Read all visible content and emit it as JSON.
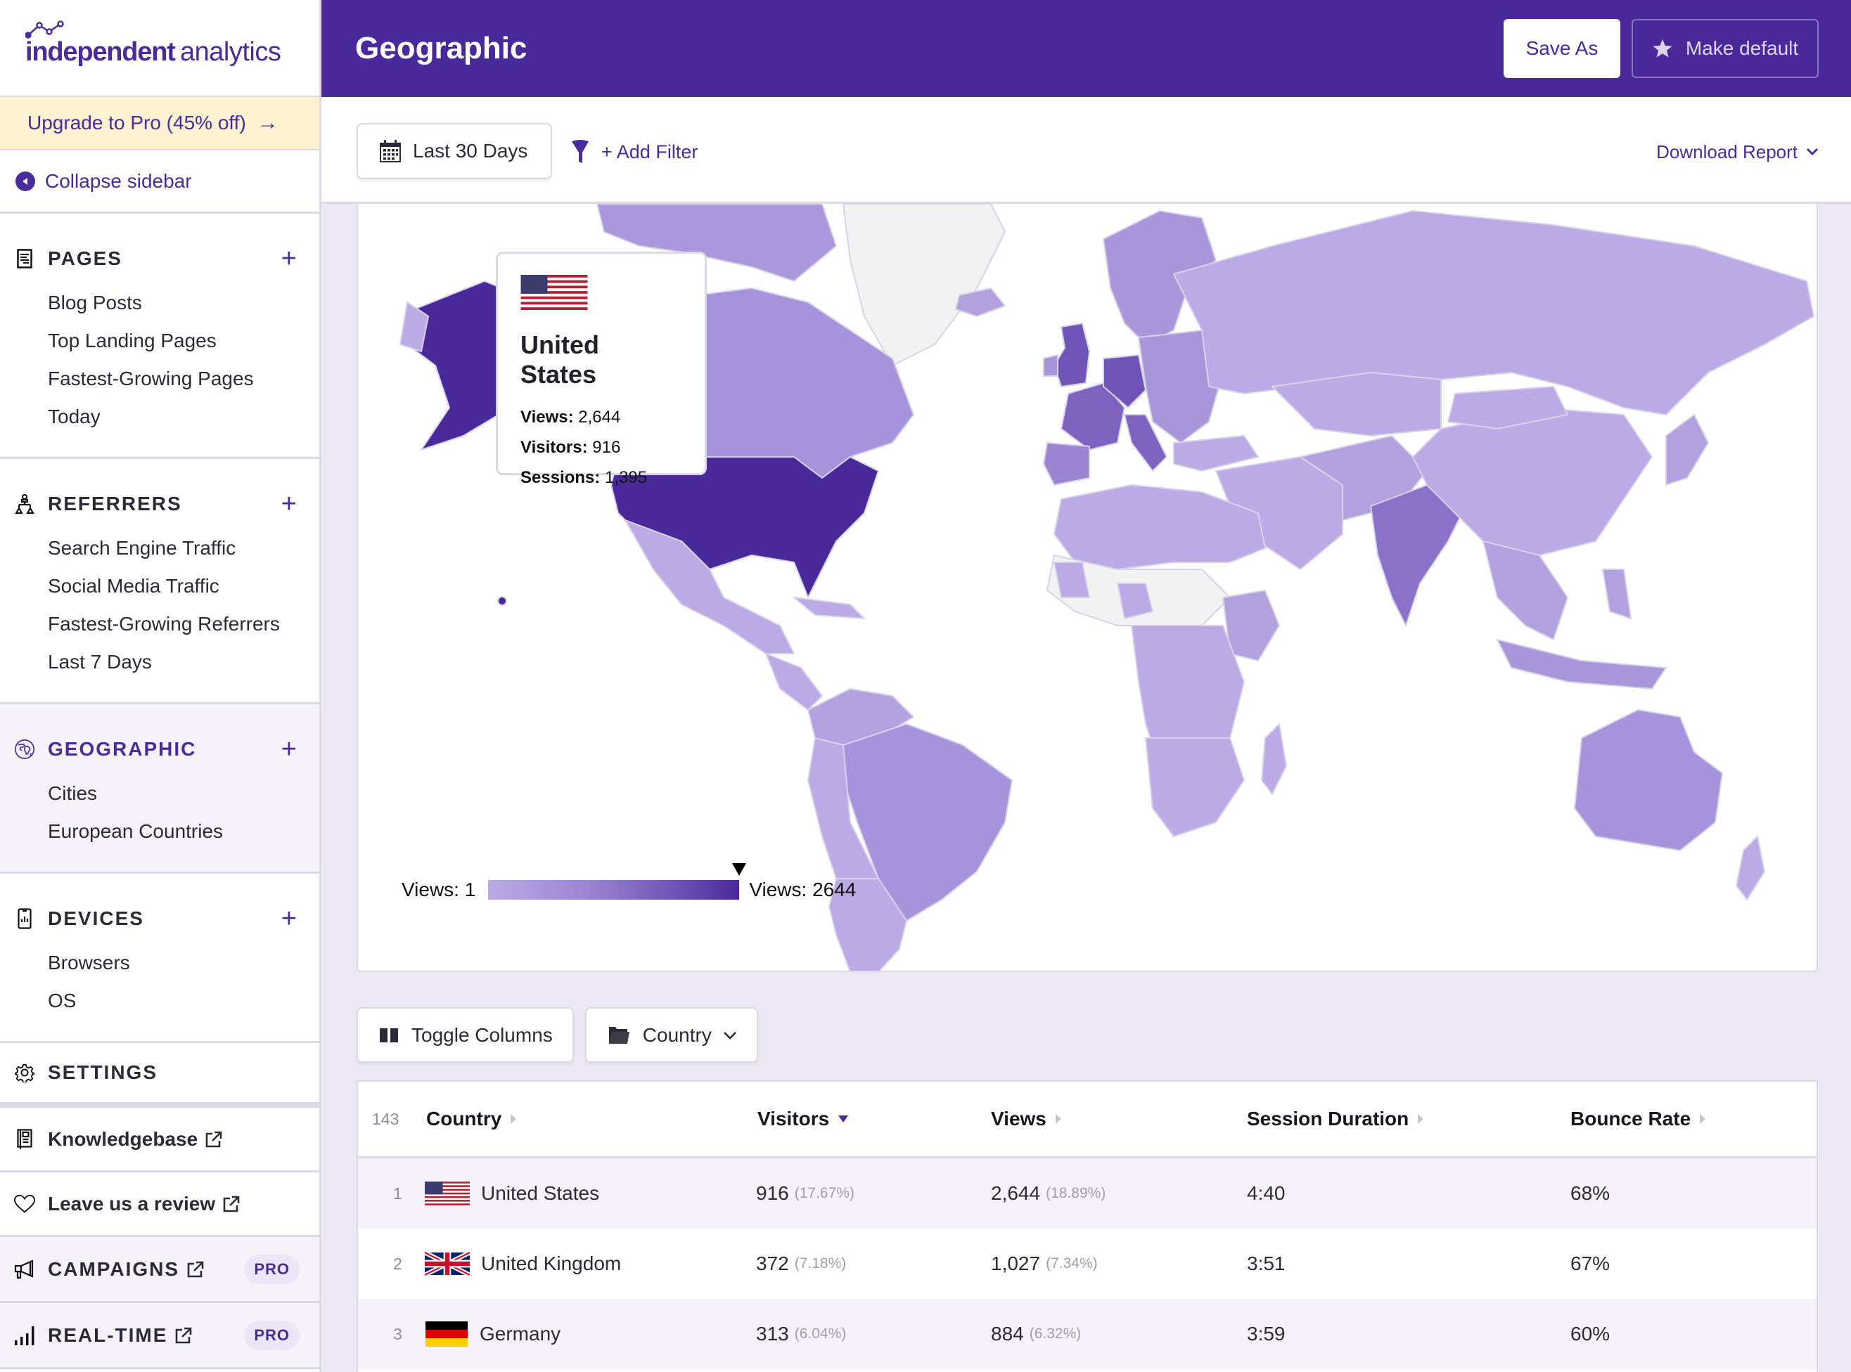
{
  "app": {
    "logo_bold": "independent",
    "logo_light": "analytics"
  },
  "sidebar": {
    "upgrade_label": "Upgrade to Pro (45% off)",
    "collapse_label": "Collapse sidebar",
    "sections": [
      {
        "title": "PAGES",
        "icon": "document-icon",
        "items": [
          "Blog Posts",
          "Top Landing Pages",
          "Fastest-Growing Pages",
          "Today"
        ]
      },
      {
        "title": "REFERRERS",
        "icon": "network-icon",
        "items": [
          "Search Engine Traffic",
          "Social Media Traffic",
          "Fastest-Growing Referrers",
          "Last 7 Days"
        ]
      },
      {
        "title": "GEOGRAPHIC",
        "icon": "globe-icon",
        "active": true,
        "items": [
          "Cities",
          "European Countries"
        ]
      },
      {
        "title": "DEVICES",
        "icon": "phone-chart-icon",
        "items": [
          "Browsers",
          "OS"
        ]
      }
    ],
    "settings_label": "SETTINGS",
    "knowledgebase_label": "Knowledgebase",
    "review_label": "Leave us a review",
    "campaigns_label": "CAMPAIGNS",
    "realtime_label": "REAL-TIME",
    "pro_badge": "PRO"
  },
  "header": {
    "title": "Geographic",
    "save_as_label": "Save As",
    "make_default_label": "Make default"
  },
  "filters": {
    "date_range": "Last 30 Days",
    "add_filter_label": "+ Add Filter",
    "download_label": "Download Report"
  },
  "map": {
    "tooltip": {
      "country": "United States",
      "views_label": "Views:",
      "views": "2,644",
      "visitors_label": "Visitors:",
      "visitors": "916",
      "sessions_label": "Sessions:",
      "sessions": "1,395"
    },
    "legend": {
      "min_label": "Views: 1",
      "max_label": "Views: 2644",
      "min": 1,
      "max": 2644,
      "hovered_value": 2644
    },
    "colors": {
      "max": "#4a2a9a",
      "high": "#7d62c0",
      "mid": "#a895da",
      "low": "#bcaae6",
      "none": "#f2f2f2"
    }
  },
  "table_toolbar": {
    "toggle_columns_label": "Toggle Columns",
    "group_by_label": "Country"
  },
  "table": {
    "row_count": "143",
    "columns": [
      "Country",
      "Visitors",
      "Views",
      "Session Duration",
      "Bounce Rate"
    ],
    "sorted_column": "Visitors",
    "rows": [
      {
        "rank": "1",
        "flag": "us",
        "country": "United States",
        "visitors": "916",
        "visitors_pct": "(17.67%)",
        "views": "2,644",
        "views_pct": "(18.89%)",
        "session_duration": "4:40",
        "bounce_rate": "68%"
      },
      {
        "rank": "2",
        "flag": "uk",
        "country": "United Kingdom",
        "visitors": "372",
        "visitors_pct": "(7.18%)",
        "views": "1,027",
        "views_pct": "(7.34%)",
        "session_duration": "3:51",
        "bounce_rate": "67%"
      },
      {
        "rank": "3",
        "flag": "de",
        "country": "Germany",
        "visitors": "313",
        "visitors_pct": "(6.04%)",
        "views": "884",
        "views_pct": "(6.32%)",
        "session_duration": "3:59",
        "bounce_rate": "60%"
      }
    ]
  },
  "theme": {
    "accent": "#4a2a9a",
    "upgrade_bg": "#fcf1d0",
    "page_bg": "#ebe8f3"
  }
}
